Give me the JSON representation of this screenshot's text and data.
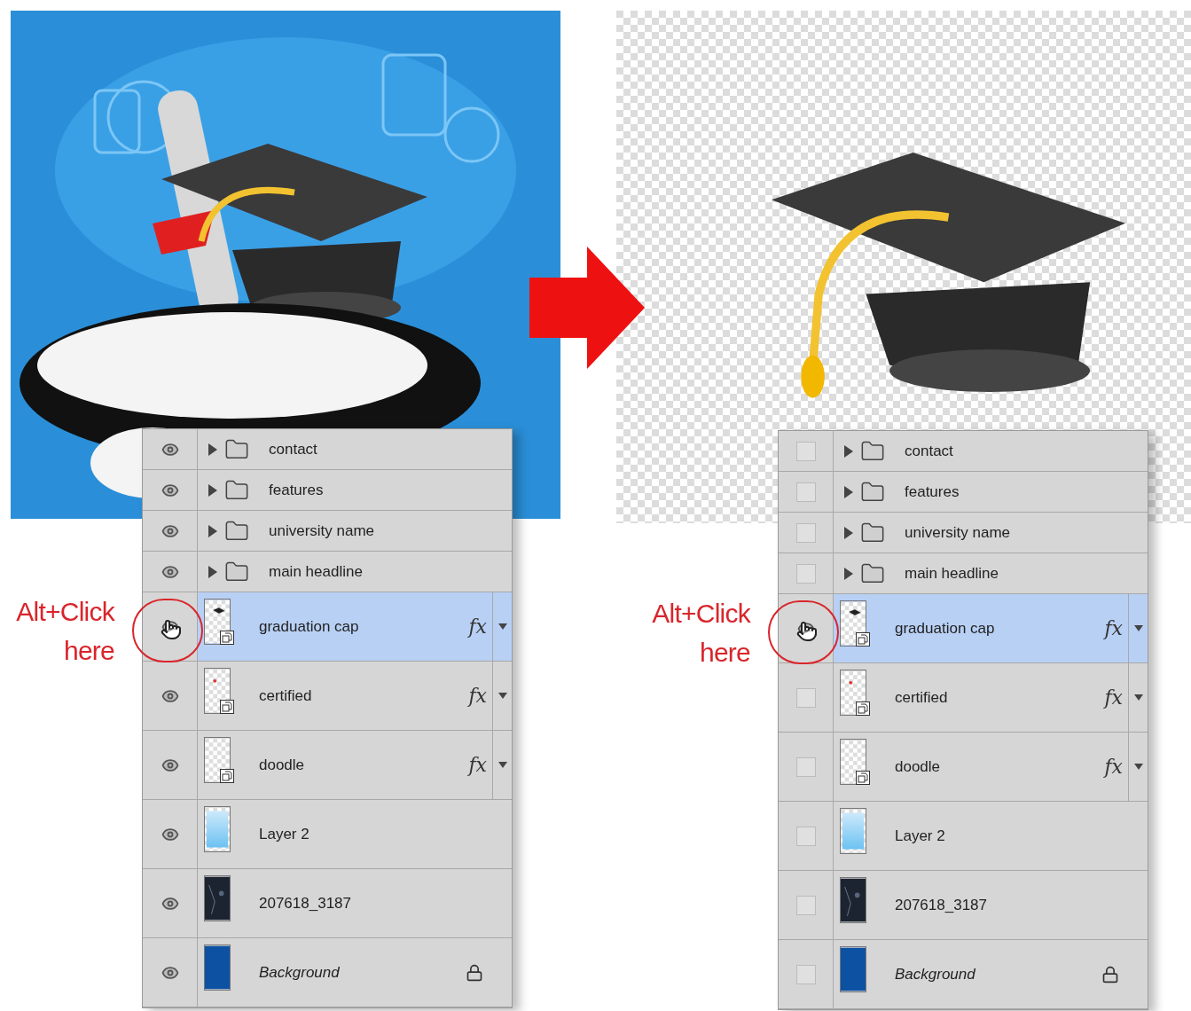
{
  "panels": [
    {
      "annotation": {
        "lines": [
          "Alt+Click",
          "here"
        ]
      },
      "layers": [
        {
          "name": "contact",
          "kind": "group",
          "visible": true,
          "selected": false
        },
        {
          "name": "features",
          "kind": "group",
          "visible": true,
          "selected": false
        },
        {
          "name": "university name",
          "kind": "group",
          "visible": true,
          "selected": false
        },
        {
          "name": "main headline",
          "kind": "group",
          "visible": true,
          "selected": false
        },
        {
          "name": "graduation cap",
          "kind": "smart",
          "visible": true,
          "selected": true,
          "effects": "fx"
        },
        {
          "name": "certified",
          "kind": "smart",
          "visible": true,
          "selected": false,
          "effects": "fx"
        },
        {
          "name": "doodle",
          "kind": "smart",
          "visible": true,
          "selected": false,
          "effects": "fx"
        },
        {
          "name": "Layer 2",
          "kind": "layer",
          "visible": true,
          "selected": false
        },
        {
          "name": "207618_3187",
          "kind": "layer",
          "visible": true,
          "selected": false
        },
        {
          "name": "Background",
          "kind": "background",
          "visible": true,
          "selected": false,
          "locked": true
        }
      ]
    },
    {
      "annotation": {
        "lines": [
          "Alt+Click",
          "here"
        ]
      },
      "layers": [
        {
          "name": "contact",
          "kind": "group",
          "visible": false,
          "selected": false
        },
        {
          "name": "features",
          "kind": "group",
          "visible": false,
          "selected": false
        },
        {
          "name": "university name",
          "kind": "group",
          "visible": false,
          "selected": false
        },
        {
          "name": "main headline",
          "kind": "group",
          "visible": false,
          "selected": false
        },
        {
          "name": "graduation cap",
          "kind": "smart",
          "visible": true,
          "selected": true,
          "effects": "fx"
        },
        {
          "name": "certified",
          "kind": "smart",
          "visible": false,
          "selected": false,
          "effects": "fx"
        },
        {
          "name": "doodle",
          "kind": "smart",
          "visible": false,
          "selected": false,
          "effects": "fx"
        },
        {
          "name": "Layer 2",
          "kind": "layer",
          "visible": false,
          "selected": false
        },
        {
          "name": "207618_3187",
          "kind": "layer",
          "visible": false,
          "selected": false
        },
        {
          "name": "Background",
          "kind": "background",
          "visible": false,
          "selected": false,
          "locked": true
        }
      ]
    }
  ]
}
